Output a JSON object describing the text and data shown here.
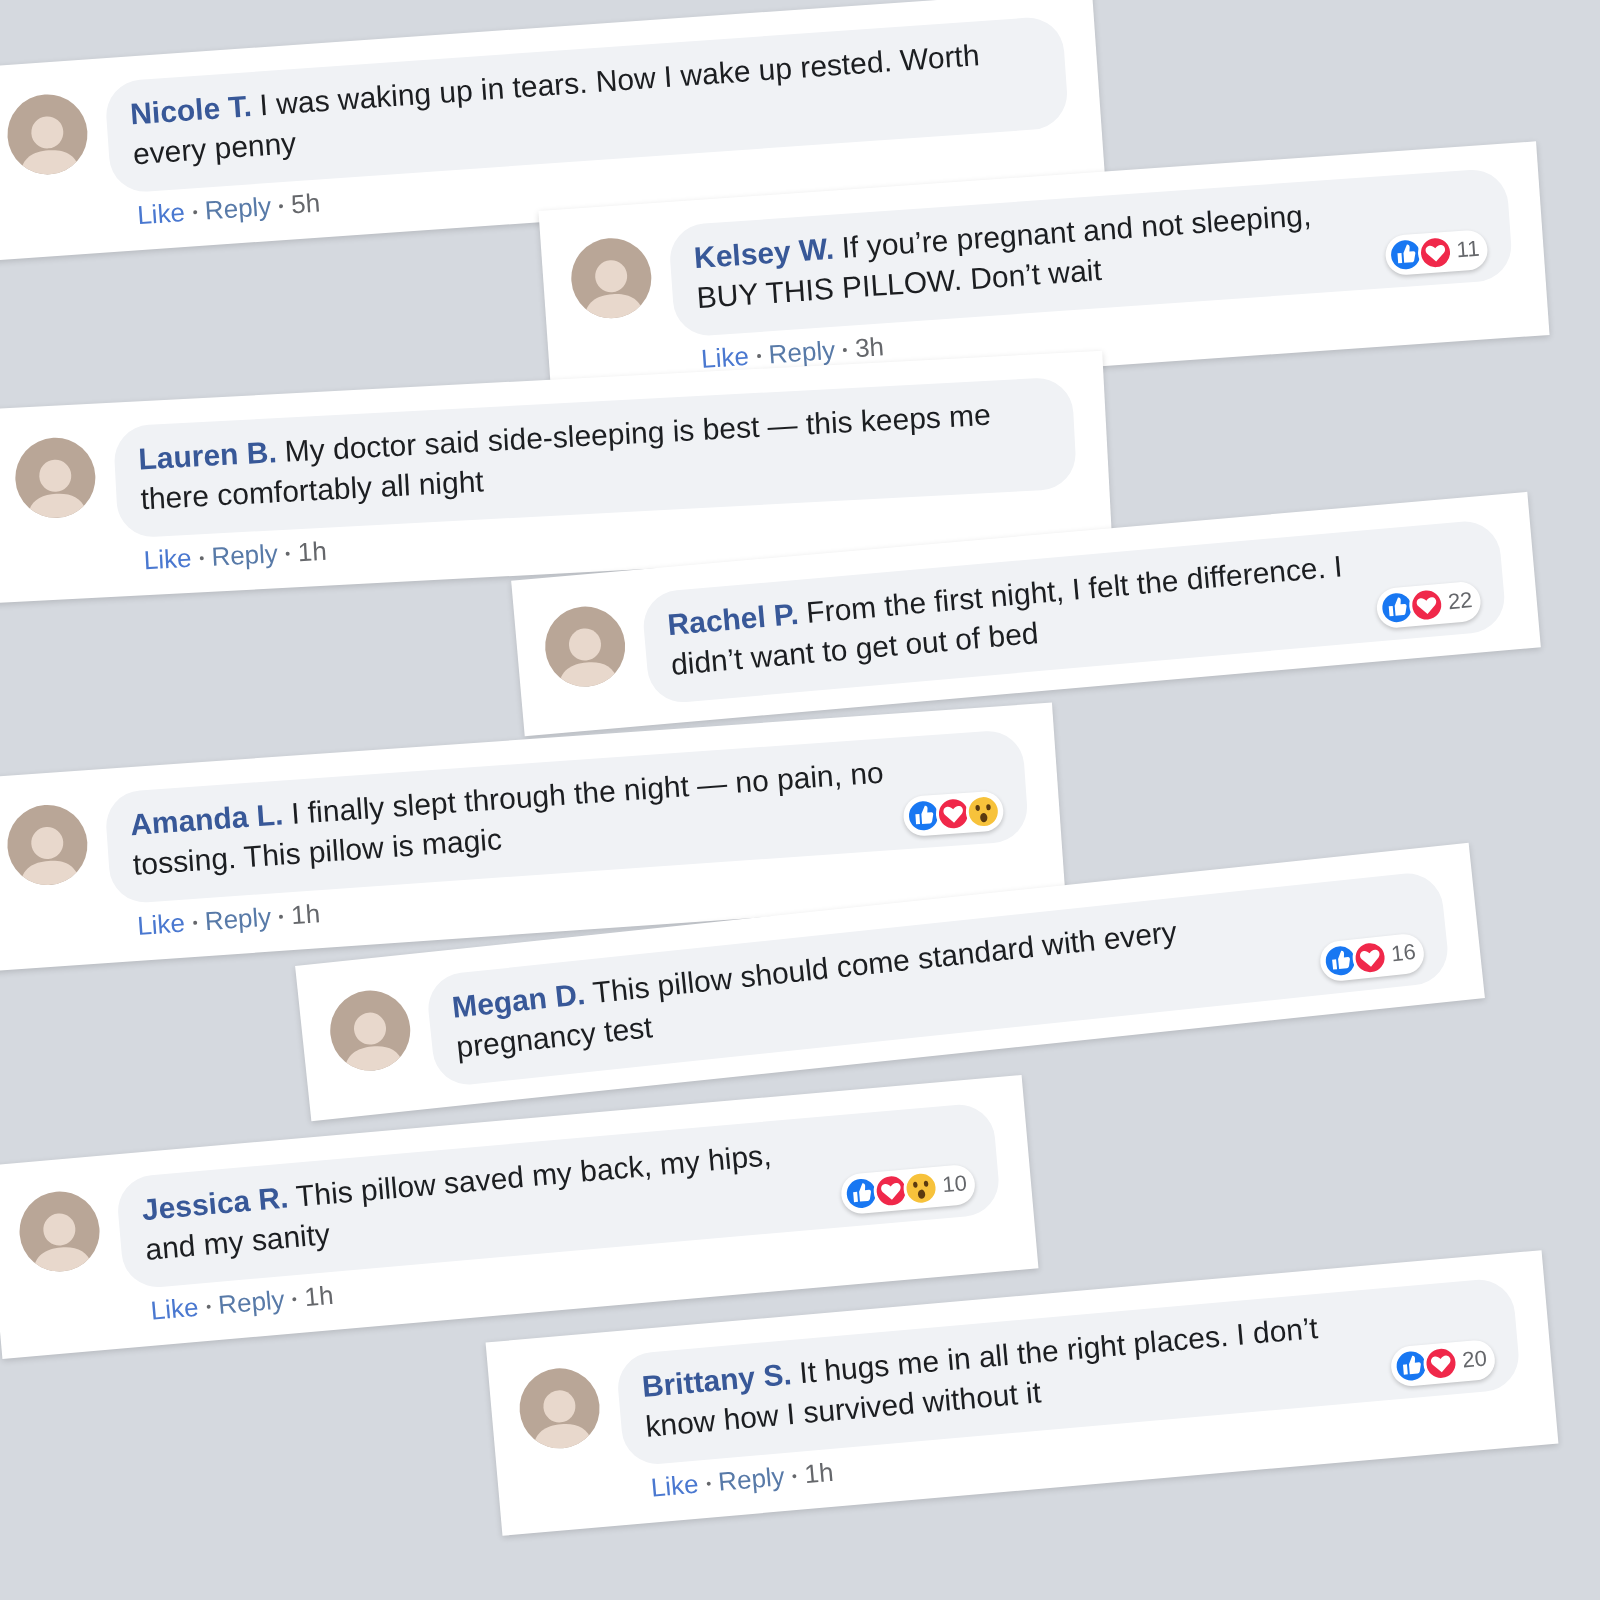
{
  "comments": [
    {
      "name": "Nicole T.",
      "text": "I was waking up in tears. Now I wake up rested. Worth every penny",
      "footer": {
        "like": "Like",
        "reply": "Reply",
        "time": "5h"
      }
    },
    {
      "name": "Kelsey W.",
      "text": "If you’re pregnant and not sleeping, BUY THIS PILLOW. Don’t wait",
      "reactions": [
        {
          "kind": "like"
        },
        {
          "kind": "love"
        }
      ],
      "reaction_count": "11",
      "footer": {
        "like": "Like",
        "reply": "Reply",
        "time": "3h"
      }
    },
    {
      "name": "Lauren B.",
      "text": "My doctor said side-sleeping is best — this keeps me there comfortably all night",
      "footer": {
        "like": "Like",
        "reply": "Reply",
        "time": "1h"
      }
    },
    {
      "name": "Rachel P.",
      "text": "From the first night, I felt the difference. I didn’t want to get out of bed",
      "reactions": [
        {
          "kind": "like"
        },
        {
          "kind": "love"
        }
      ],
      "reaction_count": "22"
    },
    {
      "name": "Amanda L.",
      "text": "I finally slept through the night — no pain, no tossing. This pillow is magic",
      "reactions": [
        {
          "kind": "like"
        },
        {
          "kind": "love"
        },
        {
          "kind": "wow"
        }
      ],
      "footer": {
        "like": "Like",
        "reply": "Reply",
        "time": "1h"
      }
    },
    {
      "name": "Megan D.",
      "text": "This pillow should come standard with every pregnancy test",
      "reactions": [
        {
          "kind": "like"
        },
        {
          "kind": "love"
        }
      ],
      "reaction_count": "16"
    },
    {
      "name": "Jessica R.",
      "text": "This pillow saved my back, my hips, and my sanity",
      "reactions": [
        {
          "kind": "like"
        },
        {
          "kind": "love"
        },
        {
          "kind": "wow"
        }
      ],
      "reaction_count": "10",
      "footer": {
        "like": "Like",
        "reply": "Reply",
        "time": "1h"
      }
    },
    {
      "name": "Brittany S.",
      "text": "It hugs me in all the right places. I don’t know how I survived without it",
      "reactions": [
        {
          "kind": "like"
        },
        {
          "kind": "love"
        }
      ],
      "reaction_count": "20",
      "footer": {
        "like": "Like",
        "reply": "Reply",
        "time": "1h"
      }
    }
  ]
}
